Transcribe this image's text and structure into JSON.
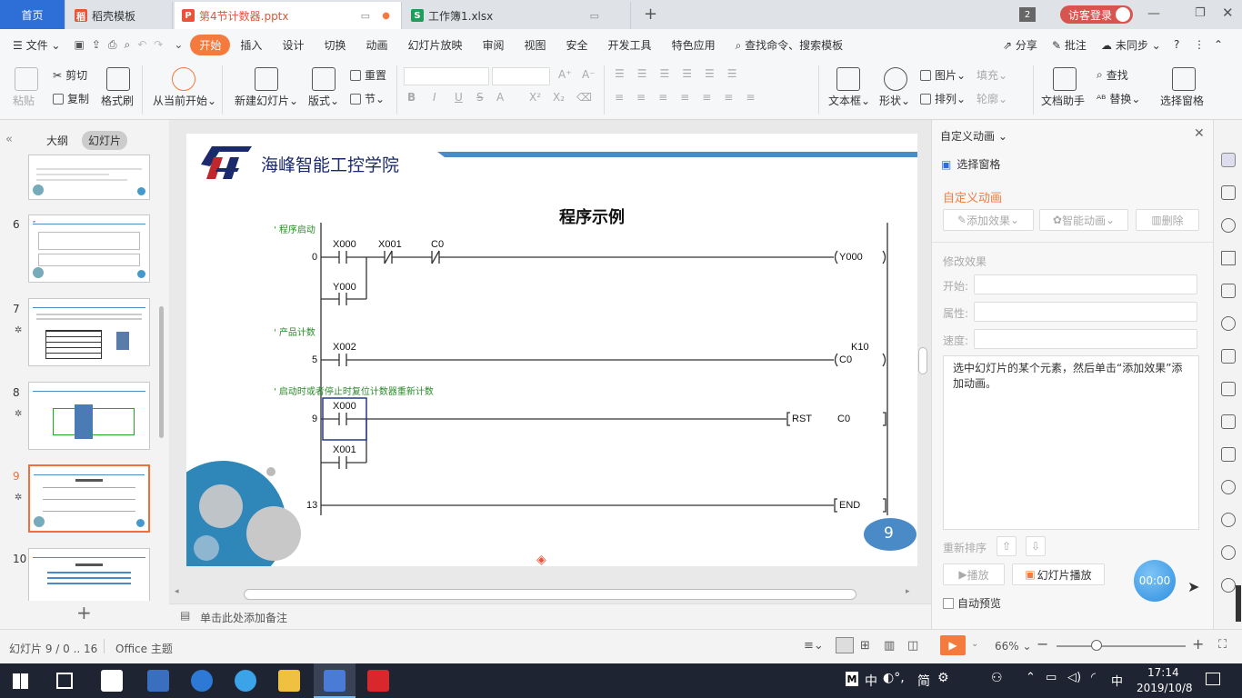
{
  "tabs": {
    "home": "首页",
    "t1": "稻壳模板",
    "t2": "第4节计数器.pptx",
    "t3": "工作簿1.xlsx",
    "count_badge": "2",
    "login": "访客登录"
  },
  "menu": {
    "file": "文件",
    "items": [
      "开始",
      "插入",
      "设计",
      "切换",
      "动画",
      "幻灯片放映",
      "审阅",
      "视图",
      "安全",
      "开发工具",
      "特色应用"
    ],
    "search": "查找命令、搜索模板",
    "share": "分享",
    "comment": "批注",
    "sync": "未同步"
  },
  "ribbon": {
    "paste": "粘贴",
    "cut": "剪切",
    "copy": "复制",
    "format_brush": "格式刷",
    "from_current": "从当前开始",
    "new_slide": "新建幻灯片",
    "layout": "版式",
    "reset": "重置",
    "section": "节",
    "textbox": "文本框",
    "shape": "形状",
    "picture": "图片",
    "fill": "填充",
    "arrange": "排列",
    "outline": "轮廓",
    "doc_helper": "文档助手",
    "find": "查找",
    "replace": "替换",
    "select_pane": "选择窗格"
  },
  "left": {
    "outline": "大纲",
    "slides": "幻灯片",
    "nums": [
      "6",
      "7",
      "8",
      "9",
      "10"
    ]
  },
  "slide": {
    "brand": "海峰智能工控学院",
    "title": "程序示例",
    "comments": [
      "' 程序启动",
      "' 产品计数",
      "' 启动时或者停止时复位计数器重新计数"
    ],
    "steps": [
      "0",
      "5",
      "9",
      "13"
    ],
    "contacts": [
      "X000",
      "X001",
      "C0",
      "Y000",
      "X002",
      "X000",
      "X001"
    ],
    "coil1": "Y000",
    "coil2_k": "K10",
    "coil2": "C0",
    "rst": "RST",
    "rst_target": "C0",
    "end": "END",
    "page": "9"
  },
  "notes": "单击此处添加备注",
  "pane": {
    "header": "自定义动画",
    "select_pane": "选择窗格",
    "section": "自定义动画",
    "add_effect": "添加效果",
    "smart_anim": "智能动画",
    "delete": "删除",
    "modify": "修改效果",
    "start": "开始:",
    "property": "属性:",
    "speed": "速度:",
    "hint": "选中幻灯片的某个元素，然后单击“添加效果”添加动画。",
    "reorder": "重新排序",
    "play": "播放",
    "slideshow": "幻灯片播放",
    "auto_preview": "自动预览",
    "timer": "00:00"
  },
  "status": {
    "slide_info": "幻灯片 9 / 0 .. 16",
    "theme": "Office 主题",
    "zoom": "66%"
  },
  "taskbar": {
    "ime": "中",
    "ime2": "简",
    "time": "17:14",
    "date": "2019/10/8",
    "lang": "中"
  },
  "colors": {
    "accent": "#f47a3d",
    "taskbar": "#1f2433",
    "brand_blue": "#2d6fd6"
  }
}
